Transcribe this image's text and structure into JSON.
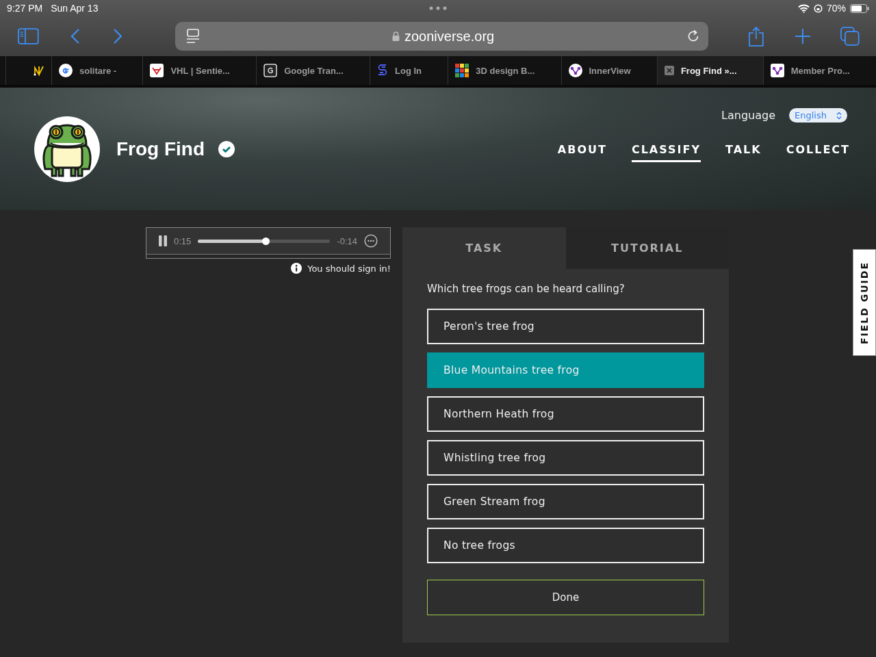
{
  "status_bar": {
    "time": "9:27 PM",
    "date": "Sun Apr 13",
    "battery": "70%"
  },
  "address_bar": {
    "url": "zooniverse.org"
  },
  "browser_tabs": [
    {
      "kind": "pinned",
      "selected": false
    },
    {
      "kind": "google",
      "label": "solitare -",
      "selected": false
    },
    {
      "kind": "vhl",
      "label": "VHL | Sentie...",
      "selected": false
    },
    {
      "kind": "letter",
      "label": "Google Tran...",
      "selected": false
    },
    {
      "kind": "s",
      "label": "Log In",
      "selected": false
    },
    {
      "kind": "grid",
      "label": "3D design B...",
      "selected": false
    },
    {
      "kind": "circle",
      "label": "InnerView",
      "selected": false
    },
    {
      "kind": "close",
      "label": "Frog Find »...",
      "selected": true
    },
    {
      "kind": "square",
      "label": "Member Pro...",
      "selected": false
    }
  ],
  "header": {
    "title": "Frog Find",
    "language_label": "Language",
    "language": "English",
    "nav": [
      {
        "label": "ABOUT",
        "selected": false
      },
      {
        "label": "CLASSIFY",
        "selected": true
      },
      {
        "label": "TALK",
        "selected": false
      },
      {
        "label": "COLLECT",
        "selected": false
      }
    ]
  },
  "player": {
    "elapsed": "0:15",
    "remaining": "-0:14",
    "level": 0.51,
    "notice": "You should sign in!"
  },
  "task_tabs": [
    {
      "label": "TASK",
      "selected": true
    },
    {
      "label": "TUTORIAL",
      "selected": false
    }
  ],
  "question": "Which tree frogs can be heard calling?",
  "answers": [
    {
      "label": "Peron's tree frog",
      "selected": false
    },
    {
      "label": "Blue Mountains tree frog",
      "selected": true
    },
    {
      "label": "Northern Heath frog",
      "selected": false
    },
    {
      "label": "Whistling tree frog",
      "selected": false
    },
    {
      "label": "Green Stream frog",
      "selected": false
    },
    {
      "label": "No tree frogs",
      "selected": false
    }
  ],
  "done_button": "Done",
  "field_guide": "FIELD GUIDE"
}
